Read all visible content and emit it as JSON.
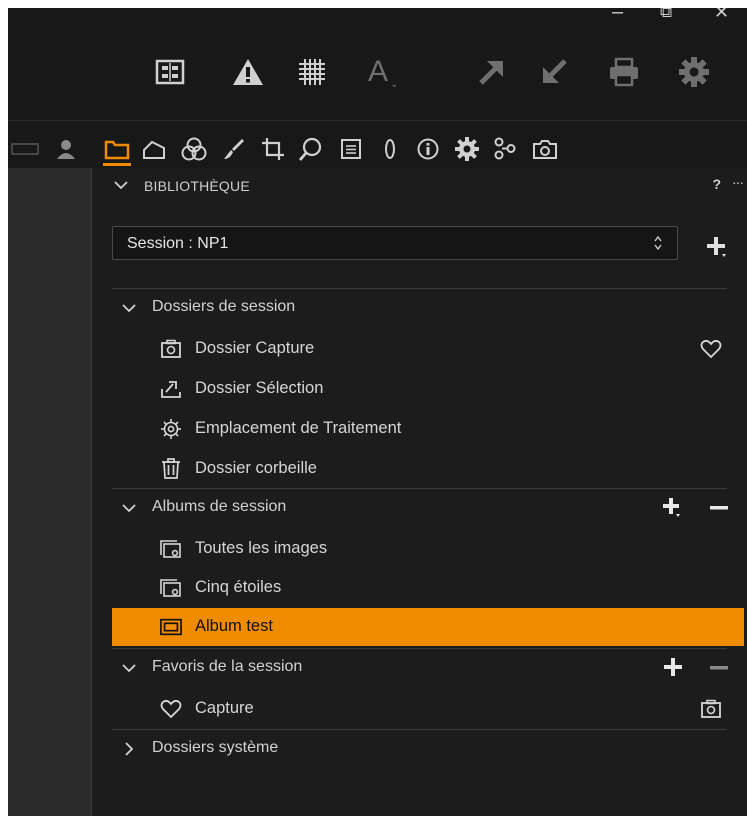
{
  "window_controls": {
    "minimize": "–",
    "restore": "⧉",
    "close": "✕"
  },
  "toolbar_icons": [
    "grid-icon",
    "warning-icon",
    "focus-mask-icon",
    "text-annotation-icon",
    "arrow-up-right-icon",
    "arrow-down-left-icon",
    "print-icon",
    "settings-icon"
  ],
  "tool_tabs": [
    "library-folder-icon",
    "capture-icon",
    "color-circles-icon",
    "brush-icon",
    "crop-icon",
    "search-icon",
    "metadata-icon",
    "lens-icon",
    "info-icon",
    "gear-icon",
    "adjustments-icon",
    "camera-icon"
  ],
  "panel": {
    "title": "BIBLIOTHÈQUE",
    "help": "?",
    "more": "···",
    "session_select": "Session :  NP1"
  },
  "sections": {
    "session_folders": {
      "label": "Dossiers de session",
      "items": [
        {
          "label": "Dossier Capture",
          "icon": "capture-folder-icon"
        },
        {
          "label": "Dossier Sélection",
          "icon": "selection-folder-icon"
        },
        {
          "label": "Emplacement de Traitement",
          "icon": "processing-gear-icon"
        },
        {
          "label": "Dossier corbeille",
          "icon": "trash-icon"
        }
      ]
    },
    "session_albums": {
      "label": "Albums de session",
      "items": [
        {
          "label": "Toutes les images",
          "icon": "smart-album-icon"
        },
        {
          "label": "Cinq étoiles",
          "icon": "smart-album-icon"
        },
        {
          "label": "Album test",
          "icon": "album-icon"
        }
      ]
    },
    "session_favorites": {
      "label": "Favoris de la session",
      "items": [
        {
          "label": "Capture",
          "icon": "heart-icon"
        }
      ]
    },
    "system_folders": {
      "label": "Dossiers système"
    }
  },
  "colors": {
    "accent": "#f08c00",
    "panel_bg": "#1c1c1c",
    "window_bg": "#181818",
    "text": "#d6d6d6"
  }
}
